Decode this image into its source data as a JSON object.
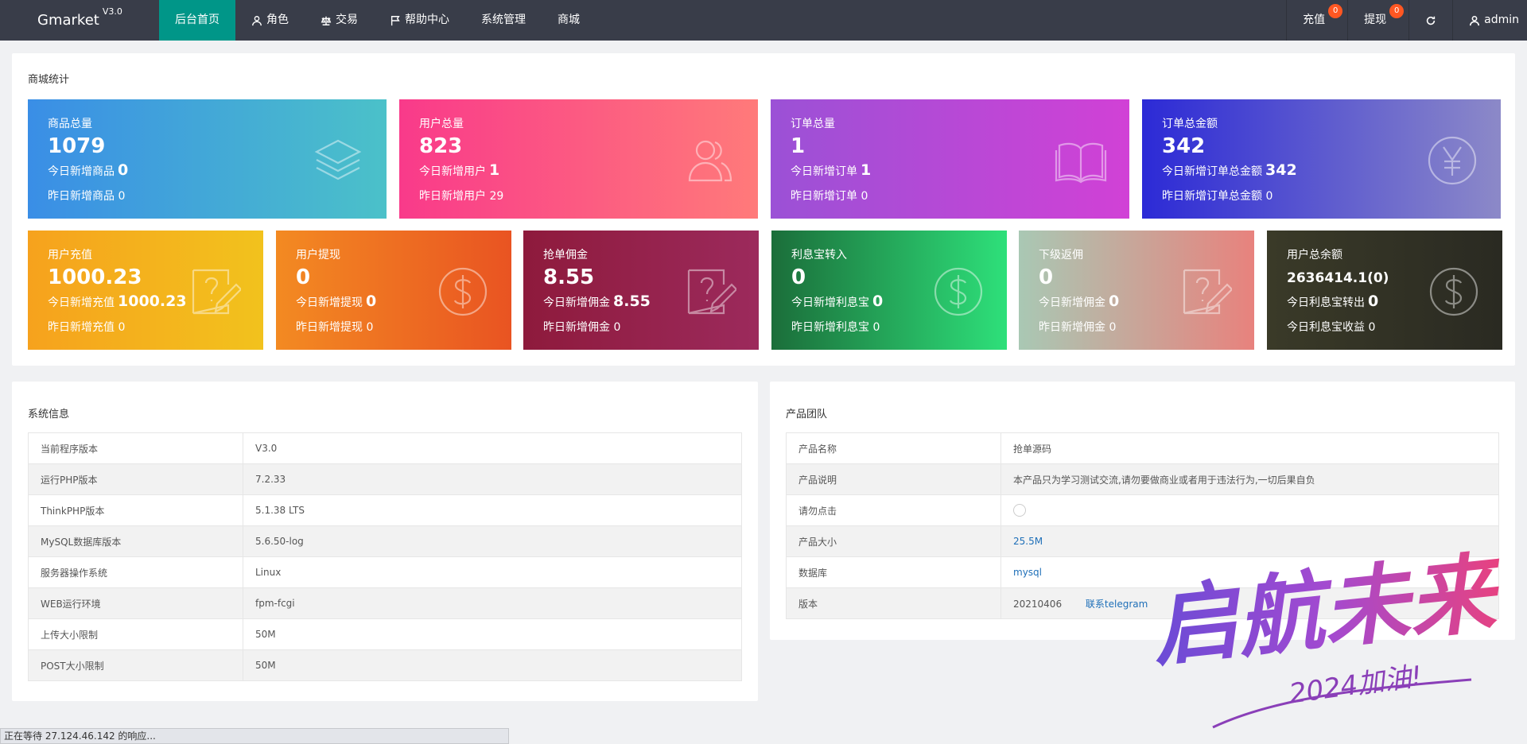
{
  "brand": {
    "name": "Gmarket",
    "version": "V3.0"
  },
  "nav": [
    {
      "label": "后台首页",
      "icon": ""
    },
    {
      "label": "角色",
      "icon": "user-icon"
    },
    {
      "label": "交易",
      "icon": "scale-icon"
    },
    {
      "label": "帮助中心",
      "icon": "flag-icon"
    },
    {
      "label": "系统管理",
      "icon": ""
    },
    {
      "label": "商城",
      "icon": ""
    }
  ],
  "right_nav": {
    "recharge": {
      "label": "充值",
      "badge": "0"
    },
    "withdraw": {
      "label": "提现",
      "badge": "0"
    },
    "user": {
      "label": "admin"
    }
  },
  "stats_section": {
    "title": "商城统计"
  },
  "stats_top": [
    {
      "title": "商品总量",
      "value": "1079",
      "today_label": "今日新增商品",
      "today_value": "0",
      "yesterday_label": "昨日新增商品",
      "yesterday_value": "0",
      "icon": "layers-icon",
      "grad": [
        "#3a8ee6",
        "#4bc1c9"
      ]
    },
    {
      "title": "用户总量",
      "value": "823",
      "today_label": "今日新增用户",
      "today_value": "1",
      "yesterday_label": "昨日新增用户",
      "yesterday_value": "29",
      "icon": "users-icon",
      "grad": [
        "#f93a8a",
        "#ff7a7a"
      ]
    },
    {
      "title": "订单总量",
      "value": "1",
      "today_label": "今日新增订单",
      "today_value": "1",
      "yesterday_label": "昨日新增订单",
      "yesterday_value": "0",
      "icon": "book-icon",
      "grad": [
        "#9b51d6",
        "#d141d6"
      ]
    },
    {
      "title": "订单总金额",
      "value": "342",
      "today_label": "今日新增订单总金额",
      "today_value": "342",
      "yesterday_label": "昨日新增订单总金额",
      "yesterday_value": "0",
      "icon": "yen-icon",
      "grad": [
        "#2c2ad6",
        "#8c89c8"
      ]
    }
  ],
  "stats_bottom": [
    {
      "title": "用户充值",
      "value": "1000.23",
      "today_label": "今日新增充值",
      "today_value": "1000.23",
      "yesterday_label": "昨日新增充值",
      "yesterday_value": "0",
      "icon": "edit-note-icon",
      "grad": [
        "#f6a21d",
        "#f2c21d"
      ]
    },
    {
      "title": "用户提现",
      "value": "0",
      "today_label": "今日新增提现",
      "today_value": "0",
      "yesterday_label": "昨日新增提现",
      "yesterday_value": "0",
      "icon": "dollar-icon",
      "grad": [
        "#f38a22",
        "#e95422"
      ]
    },
    {
      "title": "抢单佣金",
      "value": "8.55",
      "today_label": "今日新增佣金",
      "today_value": "8.55",
      "yesterday_label": "昨日新增佣金",
      "yesterday_value": "0",
      "icon": "edit-note-icon",
      "grad": [
        "#8e1a3c",
        "#9c2a5c"
      ]
    },
    {
      "title": "利息宝转入",
      "value": "0",
      "today_label": "今日新增利息宝",
      "today_value": "0",
      "yesterday_label": "昨日新增利息宝",
      "yesterday_value": "0",
      "icon": "dollar-icon",
      "grad": [
        "#1b6e3a",
        "#2ee07a"
      ]
    },
    {
      "title": "下级返佣",
      "value": "0",
      "today_label": "今日新增佣金",
      "today_value": "0",
      "yesterday_label": "昨日新增佣金",
      "yesterday_value": "0",
      "icon": "edit-note-icon",
      "grad": [
        "#a9c8b4",
        "#e8827d"
      ]
    },
    {
      "title": "用户总余额",
      "value": "2636414.1(0)",
      "today_label": "今日利息宝转出",
      "today_value": "0",
      "yesterday_label": "今日利息宝收益",
      "yesterday_value": "0",
      "icon": "dollar-icon",
      "grad": [
        "#3a3a28",
        "#2a2a22"
      ]
    }
  ],
  "system_info": {
    "title": "系统信息",
    "rows": [
      {
        "k": "当前程序版本",
        "v": "V3.0"
      },
      {
        "k": "运行PHP版本",
        "v": "7.2.33"
      },
      {
        "k": "ThinkPHP版本",
        "v": "5.1.38 LTS"
      },
      {
        "k": "MySQL数据库版本",
        "v": "5.6.50-log"
      },
      {
        "k": "服务器操作系统",
        "v": "Linux"
      },
      {
        "k": "WEB运行环境",
        "v": "fpm-fcgi"
      },
      {
        "k": "上传大小限制",
        "v": "50M"
      },
      {
        "k": "POST大小限制",
        "v": "50M"
      }
    ]
  },
  "product_team": {
    "title": "产品团队",
    "name_label": "产品名称",
    "name_value": "抢单源码",
    "desc_label": "产品说明",
    "desc_value": "本产品只为学习测试交流,请勿要做商业或者用于违法行为,一切后果自负",
    "click_label": "请勿点击",
    "size_label": "产品大小",
    "size_value": "25.5M",
    "db_label": "数据库",
    "db_value": "mysql",
    "version_label": "版本",
    "version_value": "20210406",
    "contact": "联系telegram"
  },
  "watermark": {
    "main": "启航未来",
    "sub": "2024加油!"
  },
  "status_bar": "正在等待 27.124.46.142 的响应..."
}
